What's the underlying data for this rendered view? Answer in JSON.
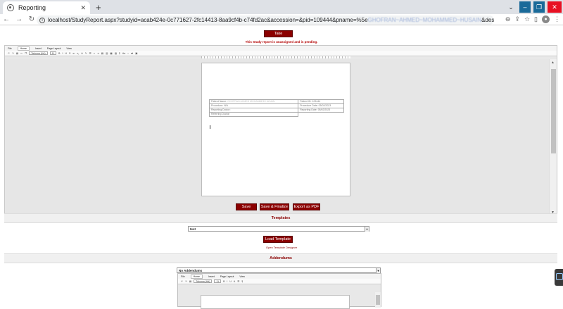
{
  "browser": {
    "tab_title": "Reporting",
    "url_visible": "localhost/StudyReport.aspx?studyid=acab424e-0c771627-2fc14413-8aa9cf4b-c74fd2ac&accession=&pid=109444&pname=%5e",
    "url_blurred": "GHOFRAN~AHMED~MOHAMMED~HUSAIN",
    "url_tail": "&des=N%2fA&s..."
  },
  "page": {
    "take_ownership": "Take Ownership",
    "pending_msg": "This Study report is unassigned and is pending."
  },
  "editor": {
    "ribbon_tabs": [
      "File",
      "Home",
      "Insert",
      "Page Layout",
      "View"
    ],
    "font_name": "Tahoma (Hd)",
    "font_size": "11",
    "report_table": {
      "patient_name_label": "Patient Name:",
      "patient_name_value": "GHOFRAN AHMED MOHAMMED HUSAIN",
      "patient_id_label": "Patient ID:",
      "patient_id_value": "109444",
      "procedure_label": "Procedure:",
      "procedure_value": "N/A",
      "procedure_date_label": "Procedure Date:",
      "procedure_date_value": "05/02/2023",
      "reporting_doctor_label": "Reporting Doctor:",
      "reporting_date_label": "Reporting Date:",
      "reporting_date_value": "05/02/2023",
      "referring_doctor_label": "Referring Doctor:"
    }
  },
  "actions": {
    "save": "Save",
    "save_finalize": "Save & Finalize",
    "export_pdf": "Export as PDF"
  },
  "templates": {
    "heading": "Templates",
    "selected": "test",
    "load_button": "Load Template",
    "designer_link": "Open Template Designer"
  },
  "addendums": {
    "heading": "Addendums",
    "selected": "No Addendums"
  }
}
